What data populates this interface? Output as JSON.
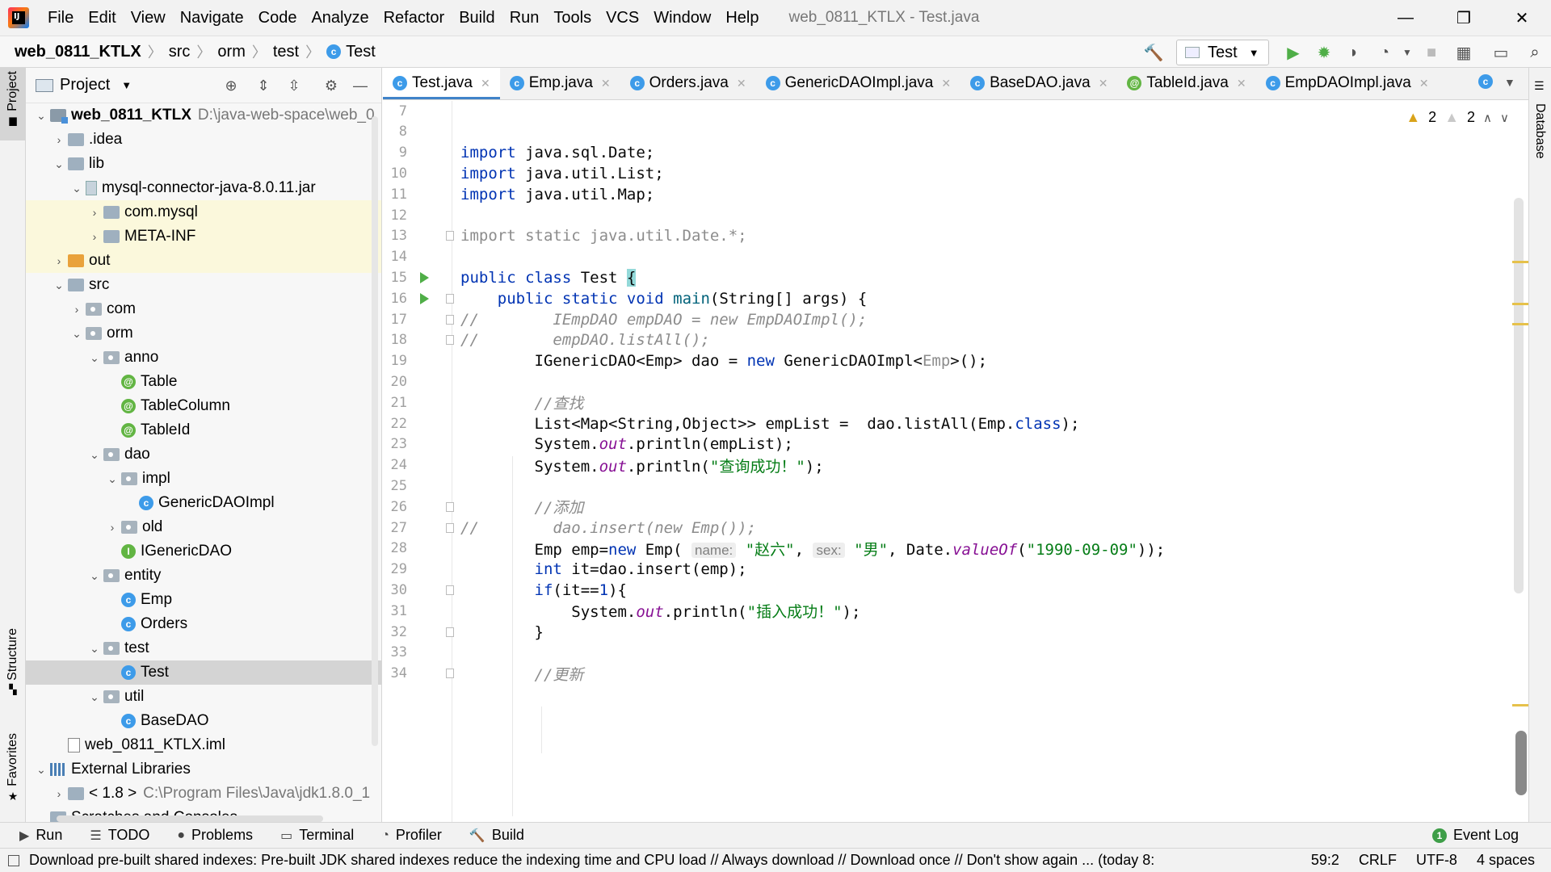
{
  "menu": {
    "items": [
      "File",
      "Edit",
      "View",
      "Navigate",
      "Code",
      "Analyze",
      "Refactor",
      "Build",
      "Run",
      "Tools",
      "VCS",
      "Window",
      "Help"
    ],
    "title": "web_0811_KTLX - Test.java"
  },
  "breadcrumb": [
    "web_0811_KTLX",
    "src",
    "orm",
    "test",
    "Test"
  ],
  "toolbar": {
    "run_config": "Test"
  },
  "left_strip": {
    "project": "Project",
    "structure": "Structure",
    "favorites": "Favorites"
  },
  "right_strip": {
    "database": "Database"
  },
  "project_panel": {
    "title": "Project",
    "tree": [
      {
        "label": "web_0811_KTLX",
        "path": "D:\\java-web-space\\web_0",
        "icon": "module-icon",
        "depth": 0,
        "arrow": "down",
        "bold": true
      },
      {
        "label": ".idea",
        "icon": "folder-icon",
        "depth": 1,
        "arrow": "right"
      },
      {
        "label": "lib",
        "icon": "folder-icon",
        "depth": 1,
        "arrow": "down"
      },
      {
        "label": "mysql-connector-java-8.0.11.jar",
        "icon": "jar-icon",
        "depth": 2,
        "arrow": "down"
      },
      {
        "label": "com.mysql",
        "icon": "folder-icon",
        "depth": 3,
        "arrow": "right",
        "highlight": true
      },
      {
        "label": "META-INF",
        "icon": "folder-icon",
        "depth": 3,
        "arrow": "right",
        "highlight": true
      },
      {
        "label": "out",
        "icon": "folder-orange-icon",
        "depth": 1,
        "arrow": "right",
        "highlight": true
      },
      {
        "label": "src",
        "icon": "folder-icon",
        "depth": 1,
        "arrow": "down"
      },
      {
        "label": "com",
        "icon": "package-icon",
        "depth": 2,
        "arrow": "right"
      },
      {
        "label": "orm",
        "icon": "package-icon",
        "depth": 2,
        "arrow": "down"
      },
      {
        "label": "anno",
        "icon": "package-icon",
        "depth": 3,
        "arrow": "down"
      },
      {
        "label": "Table",
        "icon": "annotation-icon",
        "depth": 4
      },
      {
        "label": "TableColumn",
        "icon": "annotation-icon",
        "depth": 4
      },
      {
        "label": "TableId",
        "icon": "annotation-icon",
        "depth": 4
      },
      {
        "label": "dao",
        "icon": "package-icon",
        "depth": 3,
        "arrow": "down"
      },
      {
        "label": "impl",
        "icon": "package-icon",
        "depth": 4,
        "arrow": "down"
      },
      {
        "label": "GenericDAOImpl",
        "icon": "class-icon",
        "depth": 5
      },
      {
        "label": "old",
        "icon": "package-icon",
        "depth": 4,
        "arrow": "right"
      },
      {
        "label": "IGenericDAO",
        "icon": "interface-icon",
        "depth": 4
      },
      {
        "label": "entity",
        "icon": "package-icon",
        "depth": 3,
        "arrow": "down"
      },
      {
        "label": "Emp",
        "icon": "class-icon",
        "depth": 4
      },
      {
        "label": "Orders",
        "icon": "class-icon",
        "depth": 4
      },
      {
        "label": "test",
        "icon": "package-icon",
        "depth": 3,
        "arrow": "down"
      },
      {
        "label": "Test",
        "icon": "class-icon",
        "depth": 4,
        "selected": true
      },
      {
        "label": "util",
        "icon": "package-icon",
        "depth": 3,
        "arrow": "down"
      },
      {
        "label": "BaseDAO",
        "icon": "class-icon",
        "depth": 4
      },
      {
        "label": "web_0811_KTLX.iml",
        "icon": "file-icon",
        "depth": 1
      },
      {
        "label": "External Libraries",
        "icon": "external-libraries-icon",
        "depth": 0,
        "arrow": "down"
      },
      {
        "label": "< 1.8 >",
        "path": "C:\\Program Files\\Java\\jdk1.8.0_1",
        "icon": "folder-icon",
        "depth": 1,
        "arrow": "right"
      },
      {
        "label": "Scratches and Consoles",
        "icon": "folder-icon",
        "depth": 0
      }
    ]
  },
  "tabs": [
    {
      "label": "Test.java",
      "icon": "class-icon",
      "active": true
    },
    {
      "label": "Emp.java",
      "icon": "class-icon"
    },
    {
      "label": "Orders.java",
      "icon": "class-icon"
    },
    {
      "label": "GenericDAOImpl.java",
      "icon": "class-icon"
    },
    {
      "label": "BaseDAO.java",
      "icon": "class-icon"
    },
    {
      "label": "TableId.java",
      "icon": "annotation-icon"
    },
    {
      "label": "EmpDAOImpl.java",
      "icon": "class-icon"
    }
  ],
  "inspections": {
    "warnings": "2",
    "weak_warnings": "2"
  },
  "editor": {
    "lines": [
      {
        "n": "7",
        "html": ""
      },
      {
        "n": "8",
        "html": ""
      },
      {
        "n": "9",
        "html": "<span class=\"kw\">import</span> java.sql.Date;"
      },
      {
        "n": "10",
        "html": "<span class=\"kw\">import</span> java.util.List;"
      },
      {
        "n": "11",
        "html": "<span class=\"kw\">import</span> java.util.Map;"
      },
      {
        "n": "12",
        "html": ""
      },
      {
        "n": "13",
        "html": "<span class=\"gr\">import static java.util.Date.*;</span>",
        "fold": true
      },
      {
        "n": "14",
        "html": ""
      },
      {
        "n": "15",
        "html": "<span class=\"kw\">public class</span> Test <span class=\"brace-hl\">{</span>",
        "run": true
      },
      {
        "n": "16",
        "html": "    <span class=\"kw\">public static void</span> <span class=\"mth\">main</span>(String[] args) {",
        "run": true,
        "fold": true
      },
      {
        "n": "17",
        "html": "<span class=\"cm\">//        IEmpDAO empDAO = new EmpDAOImpl();</span>",
        "fold": true
      },
      {
        "n": "18",
        "html": "<span class=\"cm\">//        empDAO.listAll();</span>",
        "fold": true
      },
      {
        "n": "19",
        "html": "        IGenericDAO&lt;Emp&gt; dao = <span class=\"kw\">new</span> GenericDAOImpl&lt;<span class=\"gr\">Emp</span>&gt;();"
      },
      {
        "n": "20",
        "html": ""
      },
      {
        "n": "21",
        "html": "        <span class=\"cm\">//查找</span>"
      },
      {
        "n": "22",
        "html": "        List&lt;Map&lt;String,Object&gt;&gt; empList =  dao.listAll(Emp.<span class=\"kw\">class</span>);"
      },
      {
        "n": "23",
        "html": "        System.<span class=\"fld\">out</span>.println(empList);"
      },
      {
        "n": "24",
        "html": "        System.<span class=\"fld\">out</span>.println(<span class=\"str\">\"查询成功！\"</span>);"
      },
      {
        "n": "25",
        "html": ""
      },
      {
        "n": "26",
        "html": "        <span class=\"cm\">//添加</span>",
        "fold": true
      },
      {
        "n": "27",
        "html": "<span class=\"cm\">//        dao.insert(new Emp());</span>",
        "fold": true
      },
      {
        "n": "28",
        "html": "        Emp emp=<span class=\"kw\">new</span> Emp( <span class=\"hint\">name:</span> <span class=\"str\">\"赵六\"</span>, <span class=\"hint\">sex:</span> <span class=\"str\">\"男\"</span>, Date.<span class=\"fld\">valueOf</span>(<span class=\"str\">\"1990-09-09\"</span>));"
      },
      {
        "n": "29",
        "html": "        <span class=\"kw\">int</span> it=dao.insert(emp);"
      },
      {
        "n": "30",
        "html": "        <span class=\"kw\">if</span>(it==<span class=\"kw\">1</span>){",
        "fold": true
      },
      {
        "n": "31",
        "html": "            System.<span class=\"fld\">out</span>.println(<span class=\"str\">\"插入成功！\"</span>);"
      },
      {
        "n": "32",
        "html": "        }",
        "fold": true
      },
      {
        "n": "33",
        "html": ""
      },
      {
        "n": "34",
        "html": "        <span class=\"cm\">//更新</span>",
        "fold": true
      }
    ]
  },
  "bottom_tools": [
    {
      "label": "Run",
      "icon": "run-icon"
    },
    {
      "label": "TODO",
      "icon": "list-icon"
    },
    {
      "label": "Problems",
      "icon": "problems-icon"
    },
    {
      "label": "Terminal",
      "icon": "terminal-icon"
    },
    {
      "label": "Profiler",
      "icon": "profiler-icon"
    },
    {
      "label": "Build",
      "icon": "build-icon"
    }
  ],
  "event_log": {
    "label": "Event Log",
    "count": "1"
  },
  "status": {
    "message": "Download pre-built shared indexes: Pre-built JDK shared indexes reduce the indexing time and CPU load // Always download // Download once // Don't show again ... (today 8:",
    "position": "59:2",
    "line_sep": "CRLF",
    "encoding": "UTF-8",
    "indent": "4 spaces"
  },
  "colors": {
    "accent": "#4083c9",
    "run_green": "#4fae47",
    "keyword": "#0033b3",
    "string": "#067d17",
    "warning": "#d9a31a"
  }
}
